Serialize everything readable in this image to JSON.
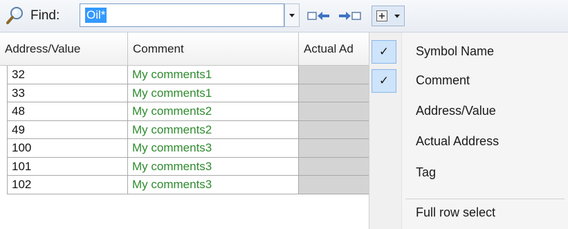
{
  "toolbar": {
    "find_label": "Find:",
    "find_value": "Oil*",
    "icons": [
      "search-icon",
      "find-previous-icon",
      "find-next-icon",
      "columns-icon"
    ]
  },
  "grid": {
    "columns": [
      "Address/Value",
      "Comment",
      "Actual Ad"
    ],
    "rows": [
      {
        "address": "32",
        "comment": "My comments1"
      },
      {
        "address": "33",
        "comment": "My comments1"
      },
      {
        "address": "48",
        "comment": "My comments2"
      },
      {
        "address": "49",
        "comment": "My comments2"
      },
      {
        "address": "100",
        "comment": "My comments3"
      },
      {
        "address": "101",
        "comment": "My comments3"
      },
      {
        "address": "102",
        "comment": "My comments3"
      }
    ]
  },
  "menu": {
    "items": [
      {
        "label": "Symbol Name",
        "checked": true
      },
      {
        "label": "Comment",
        "checked": true
      },
      {
        "label": "Address/Value",
        "checked": false
      },
      {
        "label": "Actual Address",
        "checked": false
      },
      {
        "label": "Tag",
        "checked": false
      },
      {
        "label": "Full row select",
        "checked": false
      }
    ],
    "check_glyph": "✓"
  },
  "colors": {
    "comment_text": "#2e8b2e",
    "selection": "#3399ff",
    "check_bg": "#cde4fb"
  }
}
